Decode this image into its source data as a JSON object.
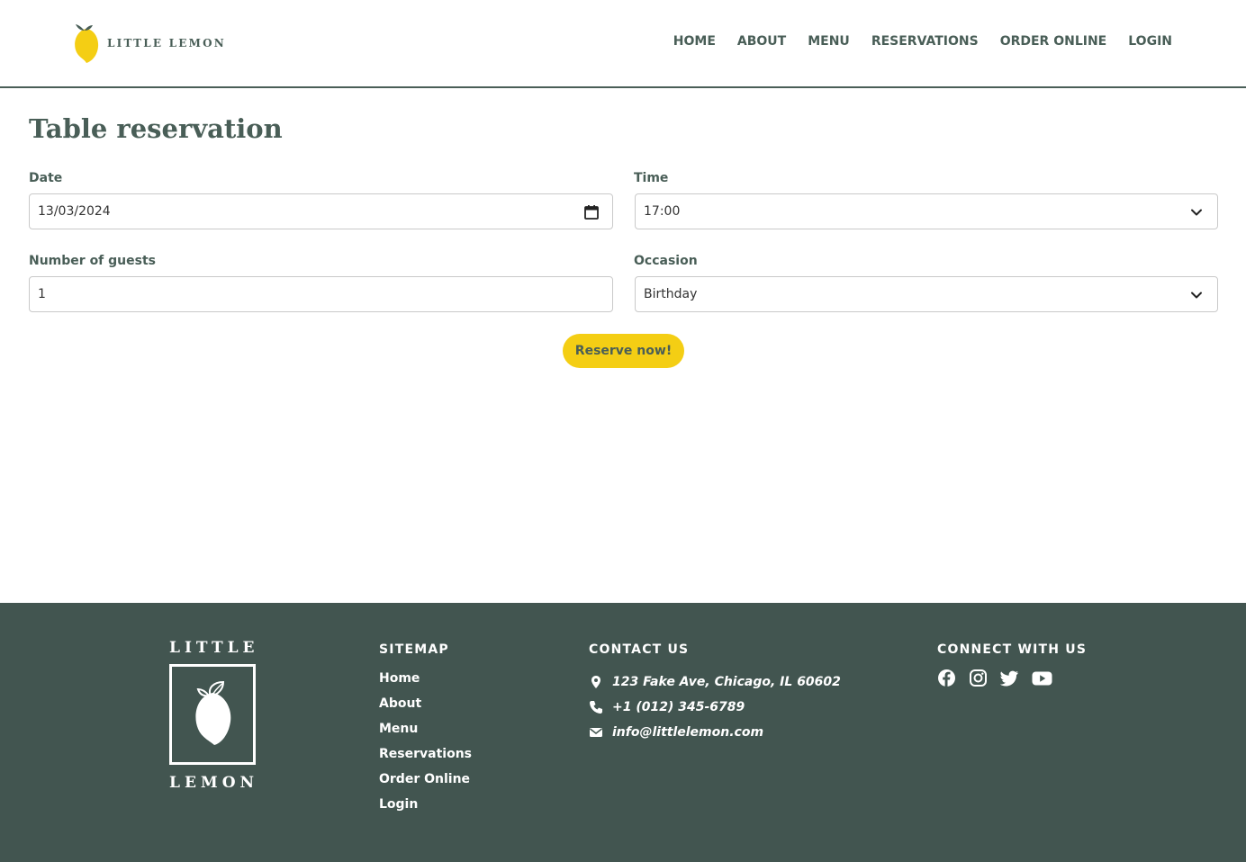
{
  "brand": {
    "name": "LITTLE LEMON",
    "footer_top": "LITTLE",
    "footer_bottom": "LEMON",
    "accent_color": "#f4ce14",
    "primary_color": "#495e57",
    "footer_color": "#425550"
  },
  "nav": {
    "items": [
      "HOME",
      "ABOUT",
      "MENU",
      "RESERVATIONS",
      "ORDER ONLINE",
      "LOGIN"
    ]
  },
  "form": {
    "title": "Table reservation",
    "date_label": "Date",
    "date_value": "13/03/2024",
    "time_label": "Time",
    "time_value": "17:00",
    "guests_label": "Number of guests",
    "guests_value": "1",
    "occasion_label": "Occasion",
    "occasion_value": "Birthday",
    "submit_label": "Reserve now!"
  },
  "footer": {
    "sitemap_heading": "SITEMAP",
    "sitemap": [
      "Home",
      "About",
      "Menu",
      "Reservations",
      "Order Online",
      "Login"
    ],
    "contact_heading": "CONTACT US",
    "address": "123 Fake Ave, Chicago, IL 60602",
    "phone": "+1 (012) 345-6789",
    "email": "info@littlelemon.com",
    "social_heading": "CONNECT WITH US",
    "social_icons": [
      "facebook-icon",
      "instagram-icon",
      "twitter-icon",
      "youtube-icon"
    ]
  }
}
